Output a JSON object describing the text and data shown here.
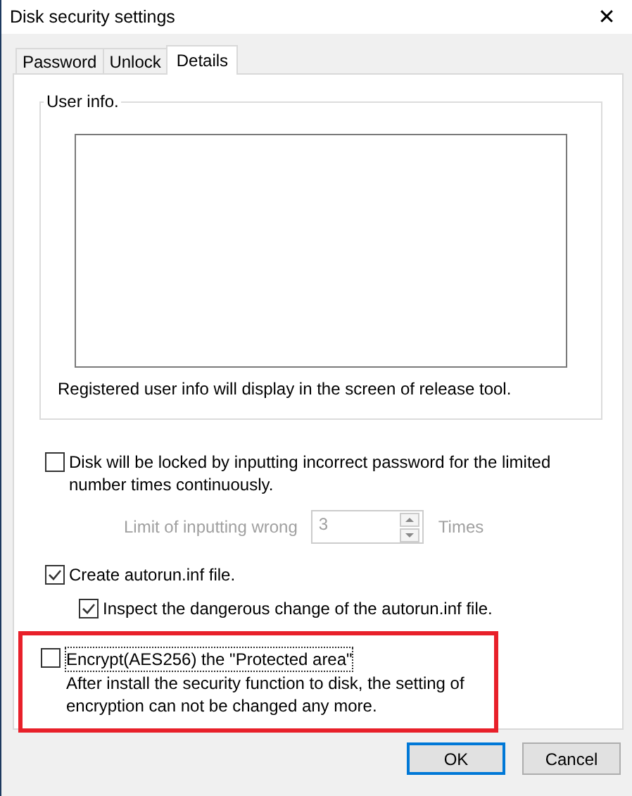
{
  "window": {
    "title": "Disk security settings",
    "close": "✕"
  },
  "tabs": [
    {
      "label": "Password",
      "selected": false
    },
    {
      "label": "Unlock",
      "selected": false
    },
    {
      "label": "Details",
      "selected": true
    }
  ],
  "user_info": {
    "legend": "User info.",
    "caption": "Registered user info will display in the screen of release tool."
  },
  "lock_option": {
    "label": "Disk will be locked by inputting incorrect password for the limited number times continuously.",
    "checked": false
  },
  "limit": {
    "label": "Limit of inputting wrong",
    "value": "3",
    "unit": "Times",
    "disabled": true
  },
  "autorun_option": {
    "label": "Create autorun.inf file.",
    "checked": true
  },
  "inspect_option": {
    "label": "Inspect the dangerous change of the autorun.inf file.",
    "checked": true
  },
  "encrypt_option": {
    "label": "Encrypt(AES256) the \"Protected area\"",
    "note": "After install the security function to disk, the setting of encryption can not be changed any more.",
    "checked": false,
    "highlighted": true
  },
  "buttons": [
    {
      "label": "OK",
      "default": true
    },
    {
      "label": "Cancel",
      "default": false
    }
  ]
}
